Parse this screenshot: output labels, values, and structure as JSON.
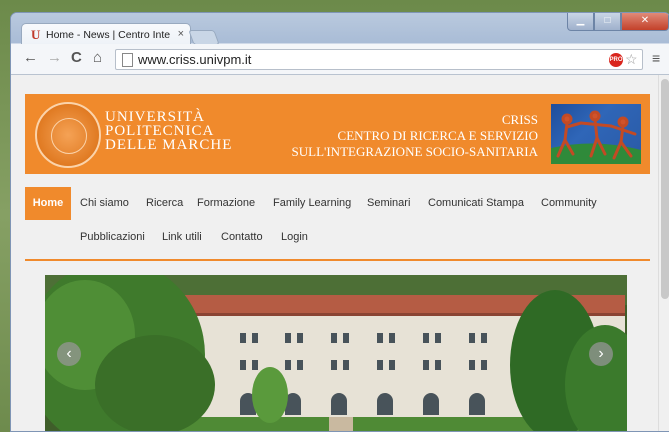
{
  "browser": {
    "tab_title": "Home - News | Centro Inte",
    "tab_favicon": "U",
    "tab_close": "×",
    "url": "www.criss.univpm.it",
    "extension_badge": "PRO"
  },
  "header": {
    "university_lines": [
      "UNIVERSITÀ",
      "POLITECNICA",
      "DELLE MARCHE"
    ],
    "center_lines": [
      "CRISS",
      "CENTRO DI RICERCA E SERVIZIO",
      "SULL'INTEGRAZIONE SOCIO-SANITARIA"
    ]
  },
  "nav": {
    "row1": [
      "Home",
      "Chi siamo",
      "Ricerca",
      "Formazione",
      "Family Learning",
      "Seminari",
      "Comunicati Stampa",
      "Community"
    ],
    "row2": [
      "Pubblicazioni",
      "Link utili",
      "Contatto",
      "Login"
    ],
    "active": "Home"
  },
  "colors": {
    "brand": "#f08a2c",
    "nav_text": "#333333"
  }
}
